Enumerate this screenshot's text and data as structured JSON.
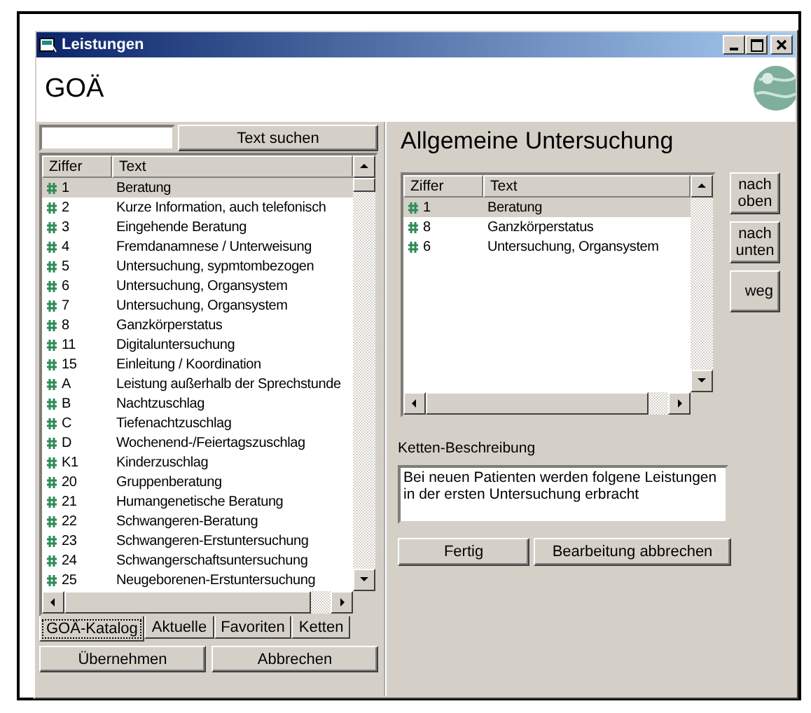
{
  "window": {
    "title": "Leistungen"
  },
  "header": {
    "title": "GOÄ"
  },
  "search": {
    "button": "Text suchen"
  },
  "catalog": {
    "columns": [
      "Ziffer",
      "Text"
    ],
    "rows": [
      {
        "code": "1",
        "text": "Beratung",
        "selected": true
      },
      {
        "code": "2",
        "text": "Kurze Information, auch telefonisch",
        "selected": false
      },
      {
        "code": "3",
        "text": "Eingehende Beratung",
        "selected": false
      },
      {
        "code": "4",
        "text": "Fremdanamnese / Unterweisung",
        "selected": false
      },
      {
        "code": "5",
        "text": "Untersuchung, sypmtombezogen",
        "selected": false
      },
      {
        "code": "6",
        "text": "Untersuchung, Organsystem",
        "selected": false
      },
      {
        "code": "7",
        "text": "Untersuchung, Organsystem",
        "selected": false
      },
      {
        "code": "8",
        "text": "Ganzkörperstatus",
        "selected": false
      },
      {
        "code": "11",
        "text": "Digitaluntersuchung",
        "selected": false
      },
      {
        "code": "15",
        "text": "Einleitung / Koordination",
        "selected": false
      },
      {
        "code": "A",
        "text": "Leistung außerhalb der Sprechstunde",
        "selected": false
      },
      {
        "code": "B",
        "text": "Nachtzuschlag",
        "selected": false
      },
      {
        "code": "C",
        "text": "Tiefenachtzuschlag",
        "selected": false
      },
      {
        "code": "D",
        "text": "Wochenend-/Feiertagszuschlag",
        "selected": false
      },
      {
        "code": "K1",
        "text": "Kinderzuschlag",
        "selected": false
      },
      {
        "code": "20",
        "text": "Gruppenberatung",
        "selected": false
      },
      {
        "code": "21",
        "text": "Humangenetische Beratung",
        "selected": false
      },
      {
        "code": "22",
        "text": "Schwangeren-Beratung",
        "selected": false
      },
      {
        "code": "23",
        "text": "Schwangeren-Erstuntersuchung",
        "selected": false
      },
      {
        "code": "24",
        "text": "Schwangerschaftsuntersuchung",
        "selected": false
      },
      {
        "code": "25",
        "text": "Neugeborenen-Erstuntersuchung",
        "selected": false
      }
    ]
  },
  "tabs": [
    {
      "label": "GOÄ-Katalog",
      "selected": true
    },
    {
      "label": "Aktuelle",
      "selected": false
    },
    {
      "label": "Favoriten",
      "selected": false
    },
    {
      "label": "Ketten",
      "selected": false
    }
  ],
  "bottom_buttons": [
    "Übernehmen",
    "Abbrechen"
  ],
  "chain": {
    "title": "Allgemeine Untersuchung",
    "columns": [
      "Ziffer",
      "Text"
    ],
    "rows": [
      {
        "code": "1",
        "text": "Beratung",
        "selected": true
      },
      {
        "code": "8",
        "text": "Ganzkörperstatus",
        "selected": false
      },
      {
        "code": "6",
        "text": "Untersuchung, Organsystem",
        "selected": false
      }
    ],
    "side_buttons": [
      "nach oben",
      "nach unten",
      "weg"
    ],
    "description_label": "Ketten-Beschreibung",
    "description": "Bei neuen Patienten werden folgene Leistungen in der ersten Untersuchung erbracht",
    "action_buttons": [
      "Fertig",
      "Bearbeitung abbrechen"
    ]
  }
}
